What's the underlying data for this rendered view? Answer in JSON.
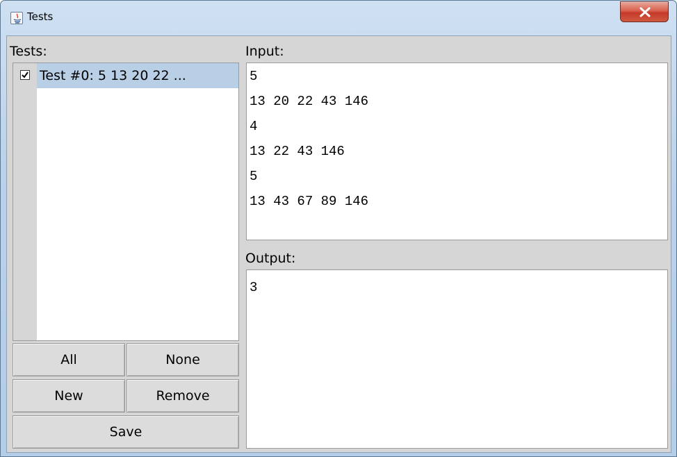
{
  "window": {
    "title": "Tests"
  },
  "tests_panel": {
    "label": "Tests:",
    "items": [
      {
        "label": "Test #0: 5 13 20 22 ...",
        "checked": true,
        "selected": true
      }
    ],
    "buttons": {
      "all": "All",
      "none": "None",
      "new": "New",
      "remove": "Remove",
      "save": "Save"
    }
  },
  "input_panel": {
    "label": "Input:",
    "lines": [
      "5",
      "13 20 22 43 146",
      "4",
      "13 22 43 146",
      "5",
      "13 43 67 89 146"
    ]
  },
  "output_panel": {
    "label": "Output:",
    "lines": [
      "3"
    ]
  },
  "colors": {
    "selection": "#b8cfe5",
    "panel_bg": "#d6d6d6",
    "close_button": "#c5392a"
  },
  "icons": {
    "app": "java-icon",
    "close": "close-icon",
    "check": "checkmark-icon"
  }
}
